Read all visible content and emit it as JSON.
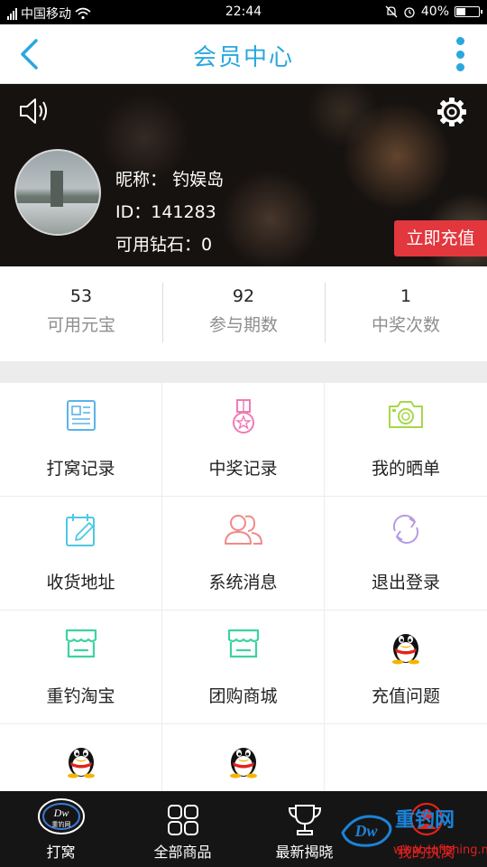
{
  "status_bar": {
    "carrier": "中国移动",
    "time": "22:44",
    "battery": "40%"
  },
  "header": {
    "title": "会员中心"
  },
  "profile": {
    "nickname_label": "昵称：",
    "nickname": "钓娱岛",
    "id_text": "ID：141283",
    "diamonds_text": "可用钻石：0",
    "recharge_label": "立即充值"
  },
  "stats": [
    {
      "value": "53",
      "label": "可用元宝"
    },
    {
      "value": "92",
      "label": "参与期数"
    },
    {
      "value": "1",
      "label": "中奖次数"
    }
  ],
  "menu": [
    {
      "label": "打窝记录",
      "icon": "document-icon",
      "color": "#5bb4e8"
    },
    {
      "label": "中奖记录",
      "icon": "medal-icon",
      "color": "#f07ab5"
    },
    {
      "label": "我的晒单",
      "icon": "camera-icon",
      "color": "#a6d84a"
    },
    {
      "label": "收货地址",
      "icon": "edit-calendar-icon",
      "color": "#4cc8e6"
    },
    {
      "label": "系统消息",
      "icon": "users-icon",
      "color": "#f08a8a"
    },
    {
      "label": "退出登录",
      "icon": "refresh-icon",
      "color": "#b79be0"
    },
    {
      "label": "重钓淘宝",
      "icon": "store-icon",
      "color": "#3cd3a1"
    },
    {
      "label": "团购商城",
      "icon": "store-icon",
      "color": "#3cd3a1"
    },
    {
      "label": "充值问题",
      "icon": "qq-penguin-icon",
      "color": "#000000"
    },
    {
      "label": "",
      "icon": "qq-penguin-icon",
      "color": "#000000"
    },
    {
      "label": "",
      "icon": "qq-penguin-icon",
      "color": "#000000"
    }
  ],
  "tabbar": [
    {
      "label": "打窝",
      "icon": "logo-icon"
    },
    {
      "label": "全部商品",
      "icon": "grid-icon"
    },
    {
      "label": "最新揭晓",
      "icon": "trophy-icon"
    },
    {
      "label": "我的执窝",
      "icon": "user-icon"
    }
  ],
  "watermark": {
    "brand": "重钓网",
    "url": "www.cqfishing.net"
  }
}
